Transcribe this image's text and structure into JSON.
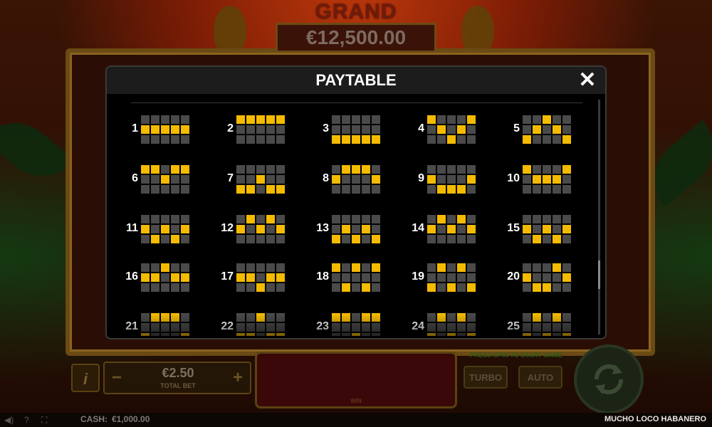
{
  "jackpot": {
    "title": "GRAND",
    "amount": "€12,500.00"
  },
  "modal": {
    "title": "PAYTABLE",
    "close_icon": "close-icon"
  },
  "paylines": [
    {
      "number": "1",
      "rows": [
        1,
        1,
        1,
        1,
        1
      ]
    },
    {
      "number": "2",
      "rows": [
        0,
        0,
        0,
        0,
        0
      ]
    },
    {
      "number": "3",
      "rows": [
        2,
        2,
        2,
        2,
        2
      ]
    },
    {
      "number": "4",
      "rows": [
        0,
        1,
        2,
        1,
        0
      ]
    },
    {
      "number": "5",
      "rows": [
        2,
        1,
        0,
        1,
        2
      ]
    },
    {
      "number": "6",
      "rows": [
        0,
        0,
        1,
        0,
        0
      ]
    },
    {
      "number": "7",
      "rows": [
        2,
        2,
        1,
        2,
        2
      ]
    },
    {
      "number": "8",
      "rows": [
        1,
        0,
        0,
        0,
        1
      ]
    },
    {
      "number": "9",
      "rows": [
        1,
        2,
        2,
        2,
        1
      ]
    },
    {
      "number": "10",
      "rows": [
        0,
        1,
        1,
        1,
        0
      ]
    },
    {
      "number": "11",
      "rows": [
        1,
        2,
        1,
        2,
        1
      ]
    },
    {
      "number": "12",
      "rows": [
        1,
        0,
        1,
        0,
        1
      ]
    },
    {
      "number": "13",
      "rows": [
        2,
        1,
        2,
        1,
        2
      ]
    },
    {
      "number": "14",
      "rows": [
        1,
        0,
        1,
        0,
        1
      ]
    },
    {
      "number": "15",
      "rows": [
        1,
        2,
        1,
        2,
        1
      ]
    },
    {
      "number": "16",
      "rows": [
        1,
        1,
        0,
        1,
        1
      ]
    },
    {
      "number": "17",
      "rows": [
        1,
        1,
        2,
        1,
        1
      ]
    },
    {
      "number": "18",
      "rows": [
        0,
        2,
        0,
        2,
        0
      ]
    },
    {
      "number": "19",
      "rows": [
        2,
        0,
        2,
        0,
        2
      ]
    },
    {
      "number": "20",
      "rows": [
        1,
        2,
        2,
        0,
        1
      ]
    },
    {
      "number": "21",
      "rows": [
        2,
        0,
        0,
        0,
        2
      ]
    },
    {
      "number": "22",
      "rows": [
        2,
        2,
        0,
        2,
        2
      ]
    },
    {
      "number": "23",
      "rows": [
        0,
        0,
        2,
        0,
        0
      ]
    },
    {
      "number": "24",
      "rows": [
        2,
        0,
        2,
        0,
        2
      ]
    },
    {
      "number": "25",
      "rows": [
        2,
        0,
        2,
        0,
        2
      ]
    }
  ],
  "controls": {
    "info_label": "i",
    "bet_minus": "−",
    "bet_plus": "+",
    "bet_value": "€2.50",
    "bet_label": "TOTAL BET",
    "win_label": "WIN",
    "press_spin": "PRESS SPIN TO START GAME",
    "turbo_label": "TURBO",
    "auto_label": "AUTO"
  },
  "status": {
    "cash_label": "CASH:",
    "cash_value": "€1,000.00",
    "game_name": "MUCHO LOCO HABANERO"
  },
  "colors": {
    "active_cell": "#f5bb00",
    "inactive_cell": "#4a4a4a",
    "modal_bg": "#000000"
  }
}
